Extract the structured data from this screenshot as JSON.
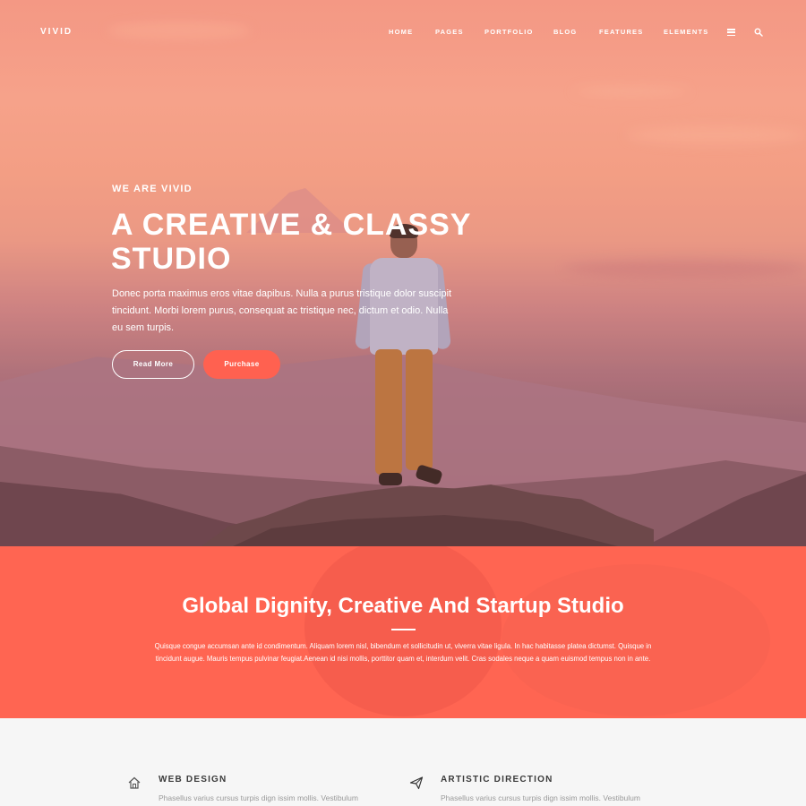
{
  "brand": {
    "logo": "VIVID"
  },
  "nav": {
    "items": [
      "HOME",
      "PAGES",
      "PORTFOLIO",
      "BLOG",
      "FEATURES",
      "ELEMENTS"
    ],
    "menu_icon": "hamburger-icon",
    "search_icon": "search-icon"
  },
  "hero": {
    "kicker": "WE ARE VIVID",
    "headline": "A CREATIVE & CLASSY STUDIO",
    "lead": "Donec porta maximus eros vitae dapibus. Nulla a purus tristique dolor suscipit tincidunt. Morbi lorem purus, consequat ac tristique nec, dictum et odio. Nulla eu sem turpis.",
    "buttons": {
      "read_more": "Read More",
      "purchase": "Purchase"
    }
  },
  "intro": {
    "title": "Global Dignity, Creative And Startup Studio",
    "text": "Quisque congue accumsan ante id condimentum. Aliquam lorem nisl, bibendum et sollicitudin ut, viverra vitae ligula. In hac habitasse platea dictumst. Quisque in tincidunt augue. Mauris tempus pulvinar feugiat.Aenean id nisi mollis, porttitor quam et, interdum velit. Cras sodales neque a quam euismod tempus non in ante."
  },
  "services": [
    {
      "icon": "home-icon",
      "title": "WEB DESIGN",
      "text": "Phasellus varius cursus turpis dign issim mollis. Vestibulum"
    },
    {
      "icon": "paper-plane-icon",
      "title": "ARTISTIC DIRECTION",
      "text": "Phasellus varius cursus turpis dign issim mollis. Vestibulum"
    }
  ],
  "colors": {
    "accent": "#ff6552",
    "button": "#ff6150",
    "text_dark": "#3a3a3a",
    "text_muted": "#9a9a9a"
  }
}
